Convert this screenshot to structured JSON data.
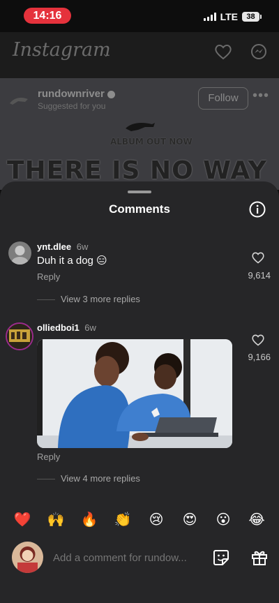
{
  "status": {
    "time": "14:16",
    "network": "LTE",
    "battery": "38"
  },
  "feed": {
    "app_title": "Instagram",
    "post_user": "rundownriver",
    "post_sub": "Suggested for you",
    "follow_label": "Follow",
    "album_text": "ALBUM OUT NOW",
    "headline": "THERE IS NO WAY"
  },
  "sheet": {
    "title": "Comments",
    "comments": [
      {
        "user": "ynt.dlee",
        "age": "6w",
        "text": "Duh it a dog 😑",
        "reply_label": "Reply",
        "likes": "9,614",
        "more_replies": "View 3 more replies"
      },
      {
        "user": "olliedboi1",
        "age": "6w",
        "text": "",
        "reply_label": "Reply",
        "likes": "9,166",
        "more_replies": "View 4 more replies"
      }
    ],
    "quick_emojis": [
      "❤️",
      "🙌",
      "🔥",
      "👏",
      "😢",
      "😍",
      "😮",
      "😂"
    ],
    "input_placeholder": "Add a comment for rundow..."
  }
}
